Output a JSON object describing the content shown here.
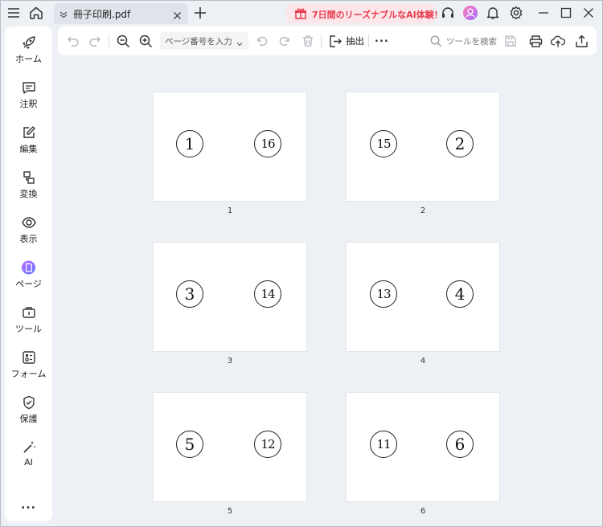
{
  "titlebar": {
    "tab_title": "冊子印刷.pdf",
    "promo_text": "7日間のリーズナブルなAI体験！"
  },
  "sidebar": {
    "items": [
      {
        "label": "ホーム",
        "icon": "rocket-icon"
      },
      {
        "label": "注釈",
        "icon": "comment-icon"
      },
      {
        "label": "編集",
        "icon": "edit-icon"
      },
      {
        "label": "変換",
        "icon": "convert-icon"
      },
      {
        "label": "表示",
        "icon": "eye-icon"
      },
      {
        "label": "ページ",
        "icon": "page-icon"
      },
      {
        "label": "ツール",
        "icon": "toolbox-icon"
      },
      {
        "label": "フォーム",
        "icon": "form-icon"
      },
      {
        "label": "保護",
        "icon": "shield-icon"
      },
      {
        "label": "AI",
        "icon": "magic-wand-icon"
      }
    ],
    "more": "..."
  },
  "toolbar": {
    "page_placeholder": "ページ番号を入力",
    "extract_label": "抽出",
    "more": "...",
    "search_label": "ツールを検索"
  },
  "pages": [
    {
      "label": "1",
      "left": "①",
      "right": "⑯"
    },
    {
      "label": "2",
      "left": "⑮",
      "right": "②"
    },
    {
      "label": "3",
      "left": "③",
      "right": "⑭"
    },
    {
      "label": "4",
      "left": "⑬",
      "right": "④"
    },
    {
      "label": "5",
      "left": "⑤",
      "right": "⑫"
    },
    {
      "label": "6",
      "left": "⑪",
      "right": "⑥"
    }
  ],
  "page_numbers_digits": [
    {
      "left": "1",
      "right": "16"
    },
    {
      "left": "15",
      "right": "2"
    },
    {
      "left": "3",
      "right": "14"
    },
    {
      "left": "13",
      "right": "4"
    },
    {
      "left": "5",
      "right": "12"
    },
    {
      "left": "11",
      "right": "6"
    }
  ],
  "colors": {
    "background": "#edf0f5",
    "promo_bg": "#fde6ea",
    "promo_text": "#e53b4d",
    "accent_purple": "#7b5cff"
  }
}
